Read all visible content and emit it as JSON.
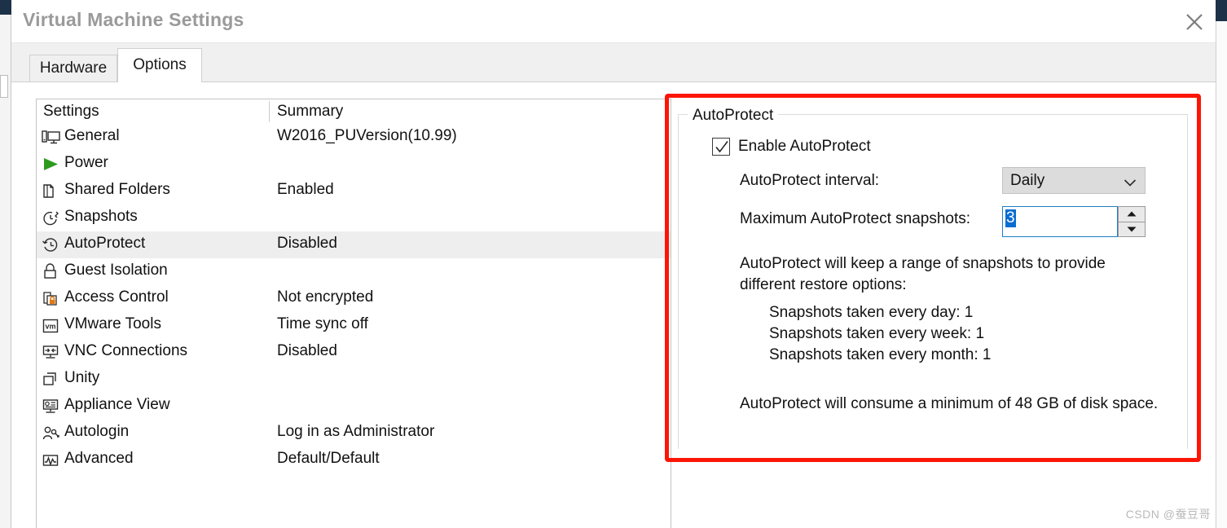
{
  "window": {
    "title": "Virtual Machine Settings",
    "close_icon": "close-icon"
  },
  "tabs": [
    {
      "label": "Hardware",
      "active": false
    },
    {
      "label": "Options",
      "active": true
    }
  ],
  "settings_list": {
    "columns": [
      "Settings",
      "Summary"
    ],
    "rows": [
      {
        "icon": "monitor-icon",
        "label": "General",
        "summary": "W2016_PUVersion(10.99)",
        "selected": false
      },
      {
        "icon": "play-triangle-icon",
        "label": "Power",
        "summary": "",
        "selected": false
      },
      {
        "icon": "folder-icon",
        "label": "Shared Folders",
        "summary": "Enabled",
        "selected": false
      },
      {
        "icon": "clock-wrench-icon",
        "label": "Snapshots",
        "summary": "",
        "selected": false
      },
      {
        "icon": "clock-back-icon",
        "label": "AutoProtect",
        "summary": "Disabled",
        "selected": true
      },
      {
        "icon": "padlock-icon",
        "label": "Guest Isolation",
        "summary": "",
        "selected": false
      },
      {
        "icon": "document-lock-icon",
        "label": "Access Control",
        "summary": "Not encrypted",
        "selected": false
      },
      {
        "icon": "vm-badge-icon",
        "label": "VMware Tools",
        "summary": "Time sync off",
        "selected": false
      },
      {
        "icon": "vnc-arrows-icon",
        "label": "VNC Connections",
        "summary": "Disabled",
        "selected": false
      },
      {
        "icon": "windows-stack-icon",
        "label": "Unity",
        "summary": "",
        "selected": false
      },
      {
        "icon": "appliance-icon",
        "label": "Appliance View",
        "summary": "",
        "selected": false
      },
      {
        "icon": "user-key-icon",
        "label": "Autologin",
        "summary": "Log in as Administrator",
        "selected": false
      },
      {
        "icon": "waveform-icon",
        "label": "Advanced",
        "summary": "Default/Default",
        "selected": false
      }
    ]
  },
  "autoprotect_panel": {
    "legend": "AutoProtect",
    "enable_checkbox": {
      "label": "Enable AutoProtect",
      "checked": true,
      "icon": "checkmark-icon"
    },
    "interval": {
      "label": "AutoProtect interval:",
      "value": "Daily",
      "chevron_icon": "chevron-down-icon"
    },
    "max_snapshots": {
      "label": "Maximum AutoProtect snapshots:",
      "value": "3",
      "up_icon": "spinner-up-icon",
      "down_icon": "spinner-down-icon"
    },
    "description_main": "AutoProtect will keep a range of snapshots to provide different restore options:",
    "description_lines": [
      "Snapshots taken every day: 1",
      "Snapshots taken every week: 1",
      "Snapshots taken every month: 1"
    ],
    "description_consume": "AutoProtect will consume a minimum of 48 GB of disk space."
  },
  "annotation": {
    "highlight_color": "#fc1505"
  },
  "watermark": "CSDN @蚕豆哥"
}
